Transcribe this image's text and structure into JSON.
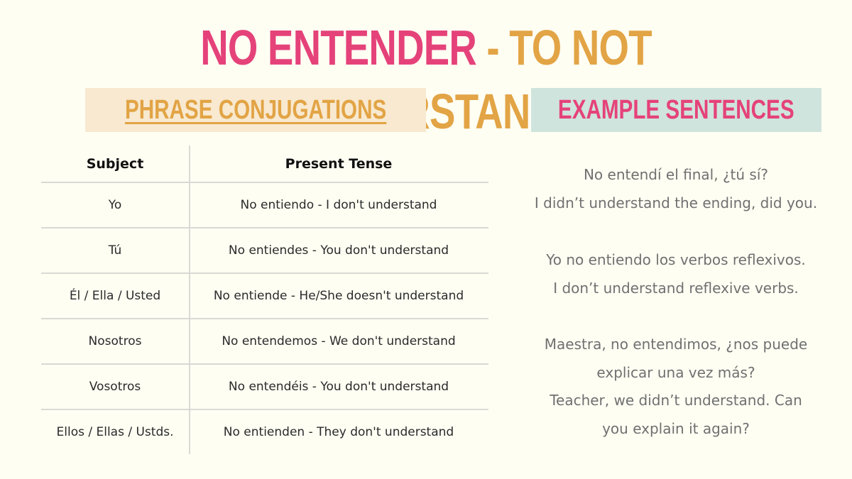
{
  "title": {
    "spanish": "NO ENTENDER",
    "separator": " - ",
    "english": "TO NOT UNDERSTAND"
  },
  "colors": {
    "pink": "#e5427a",
    "orange": "#e2a445",
    "background": "#fefef3",
    "left_banner_bg": "#f8e9d0",
    "right_banner_bg": "#cfe4dd"
  },
  "conjugations": {
    "heading": "PHRASE CONJUGATIONS",
    "columns": [
      "Subject",
      "Present Tense"
    ],
    "rows": [
      {
        "subject": "Yo",
        "present": "No entiendo - I don't understand"
      },
      {
        "subject": "Tú",
        "present": "No entiendes - You don't understand"
      },
      {
        "subject": "Él / Ella / Usted",
        "present": "No entiende - He/She doesn't understand"
      },
      {
        "subject": "Nosotros",
        "present": "No entendemos - We don't understand"
      },
      {
        "subject": "Vosotros",
        "present": "No entendéis - You don't understand"
      },
      {
        "subject": "Ellos / Ellas / Ustds.",
        "present": "No entienden - They don't understand"
      }
    ]
  },
  "examples": {
    "heading": "EXAMPLE SENTENCES",
    "sentences": [
      {
        "lines": [
          "No entendí el final, ¿tú sí?",
          "I didn’t understand the ending, did you."
        ]
      },
      {
        "lines": [
          "Yo no entiendo los verbos reflexivos.",
          "I don’t understand reflexive verbs."
        ]
      },
      {
        "lines": [
          "Maestra, no entendimos, ¿nos puede",
          "explicar una vez más?",
          "Teacher, we didn’t understand. Can",
          "you explain it again?"
        ]
      }
    ]
  }
}
